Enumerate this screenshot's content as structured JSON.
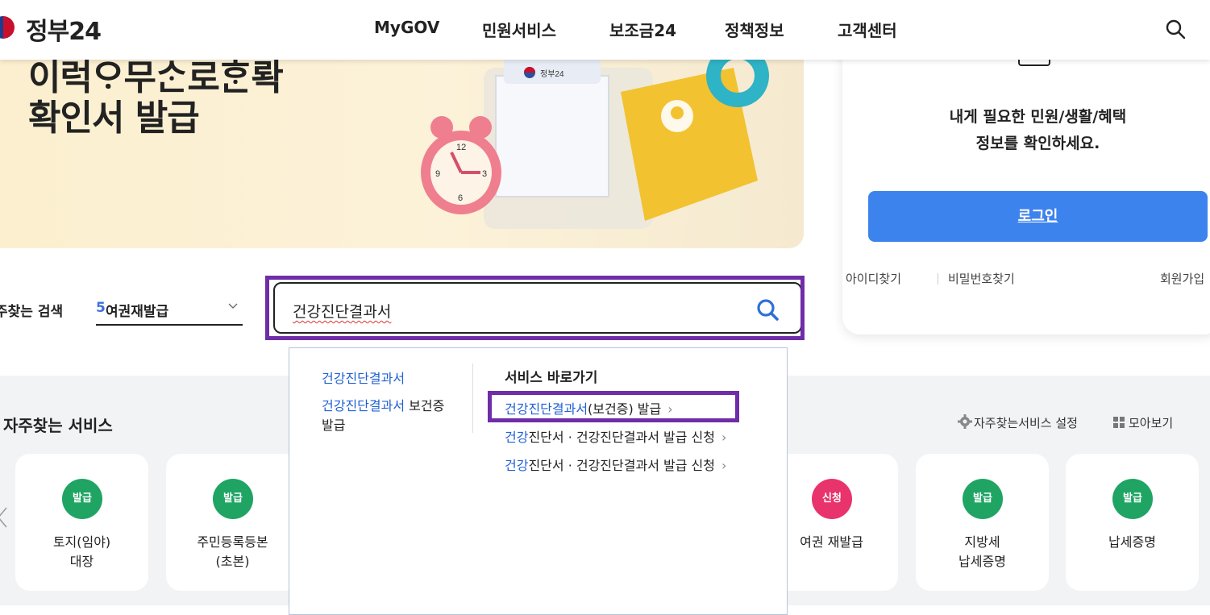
{
  "header": {
    "logo_text": "정부24",
    "nav": [
      "MyGOV",
      "민원서비스",
      "보조금24",
      "정책정보",
      "고객센터"
    ]
  },
  "hero": {
    "title_line1": "이럭ᄋᆞ무ᄉᆞᆫ로ᄒᆞᆫ롹",
    "title_line2": "확인서 발급",
    "illustration_label": "정부24"
  },
  "login": {
    "message_line1": "내게 필요한 민원/생활/혜택",
    "message_line2": "정보를 확인하세요.",
    "button": "로그인",
    "find_id": "아이디찾기",
    "find_password": "비밀번호찾기",
    "signup": "회원가입"
  },
  "search": {
    "freq_label": "주찾는 검색",
    "freq_selected_num": "5",
    "freq_selected_text": "여권재발급",
    "query": "건강진단결과서"
  },
  "autocomplete": {
    "suggestions": [
      {
        "hl": "건강진단결과서",
        "rest": ""
      },
      {
        "hl": "건강진단결과서",
        "rest": " 보건증"
      },
      {
        "hl": "",
        "rest": "발급"
      }
    ],
    "shortcut_heading": "서비스 바로가기",
    "shortcuts": [
      {
        "hl": "건강진단결과서",
        "rest": "(보건증) 발급"
      },
      {
        "hl": "건강",
        "rest": "진단서 · 건강진단결과서 발급 신청"
      },
      {
        "hl": "건강",
        "rest": "진단서 · 건강진단결과서 발급 신청"
      }
    ],
    "arrow": "›"
  },
  "frequent_services": {
    "title": "자주찾는 서비스",
    "setting_label": "자주찾는서비스 설정",
    "view_all_label": "모아보기",
    "cards": [
      {
        "badge": "발급",
        "badge_color": "#1fa463",
        "name_line1": "토지(임야)",
        "name_line2": "대장"
      },
      {
        "badge": "발급",
        "badge_color": "#1fa463",
        "name_line1": "주민등록등본",
        "name_line2": "(초본)"
      },
      {
        "badge": "신청",
        "badge_color": "#e8336d",
        "name_line1": "여권 재발급",
        "name_line2": ""
      },
      {
        "badge": "발급",
        "badge_color": "#1fa463",
        "name_line1": "지방세",
        "name_line2": "납세증명"
      },
      {
        "badge": "발급",
        "badge_color": "#1fa463",
        "name_line1": "납세증명",
        "name_line2": ""
      }
    ]
  },
  "colors": {
    "accent_blue": "#3d83ee",
    "highlight_purple": "#6f2da8",
    "issue_green": "#1fa463",
    "apply_pink": "#e8336d"
  }
}
